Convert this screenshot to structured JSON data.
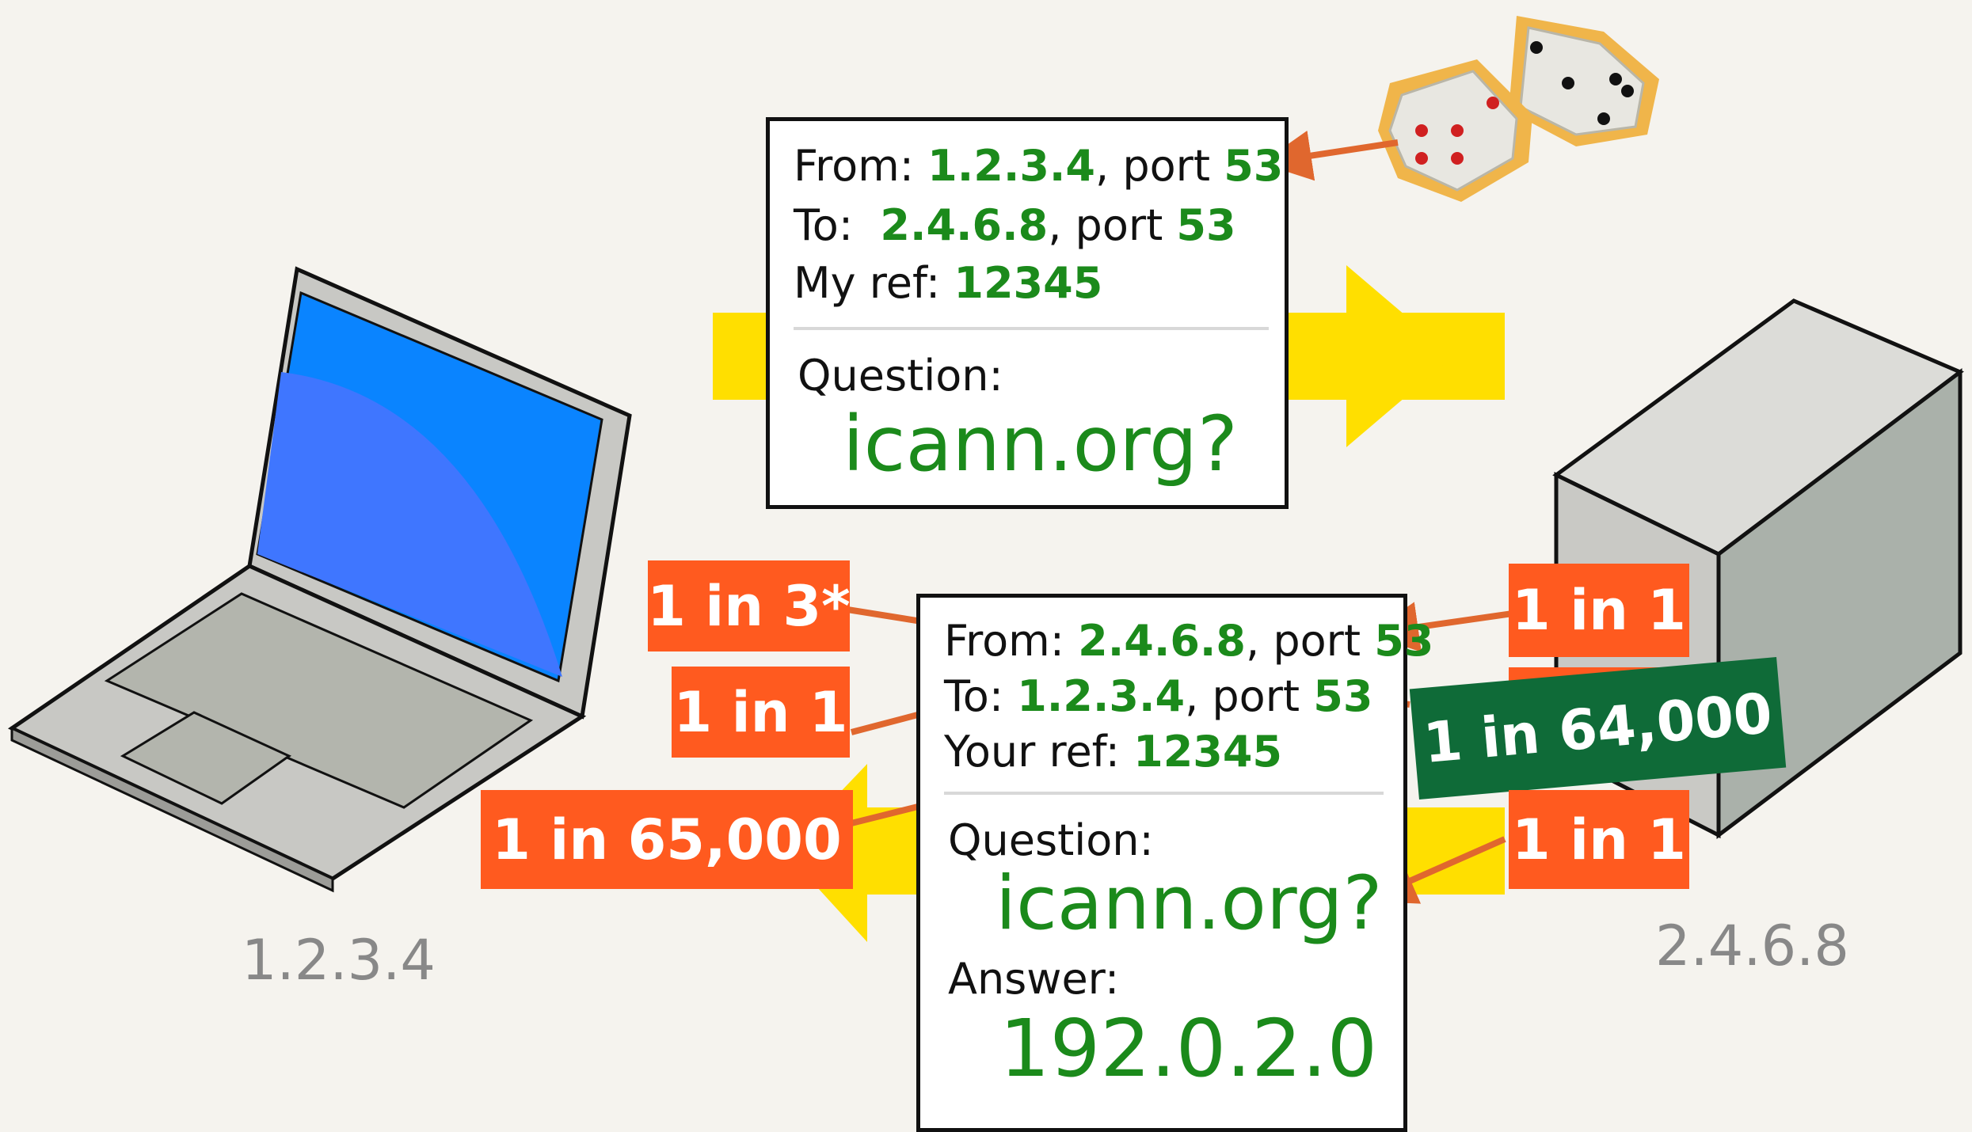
{
  "query": {
    "from_prefix": "From: ",
    "from_ip": "1.2.3.4",
    "from_port_prefix": ", port ",
    "from_port": "53",
    "to_prefix": "To:  ",
    "to_ip": "2.4.6.8",
    "to_port_prefix": ", port ",
    "to_port": "53",
    "ref_prefix": "My ref: ",
    "ref": "12345",
    "question_label": "Question:",
    "question": "icann.org?"
  },
  "response": {
    "from_prefix": "From: ",
    "from_ip": "2.4.6.8",
    "from_port_prefix": ", port ",
    "from_port": "53",
    "to_prefix": "To: ",
    "to_ip": "1.2.3.4",
    "to_port_prefix": ", port ",
    "to_port": "53",
    "ref_prefix": "Your ref: ",
    "ref": "12345",
    "question_label": "Question:",
    "question": "icann.org?",
    "answer_label": "Answer:",
    "answer": "192.0.2.0"
  },
  "badges": {
    "one_in_three": "1 in 3*",
    "one_in_one_a": "1 in 1",
    "one_in_65000": "1 in 65,000",
    "one_in_one_b": "1 in 1",
    "one_in_64000": "1 in 64,000",
    "one_in_one_c": "1 in 1"
  },
  "hosts": {
    "client_address": "1.2.3.4",
    "server_address": "2.4.6.8"
  },
  "colors": {
    "accent_orange": "#ff5a1f",
    "arrow_orange": "#e0672e",
    "value_green": "#1b8a1b",
    "badge_green": "#0f6b38",
    "flow_yellow": "#ffdf00",
    "screen_blue": "#0a84ff"
  }
}
